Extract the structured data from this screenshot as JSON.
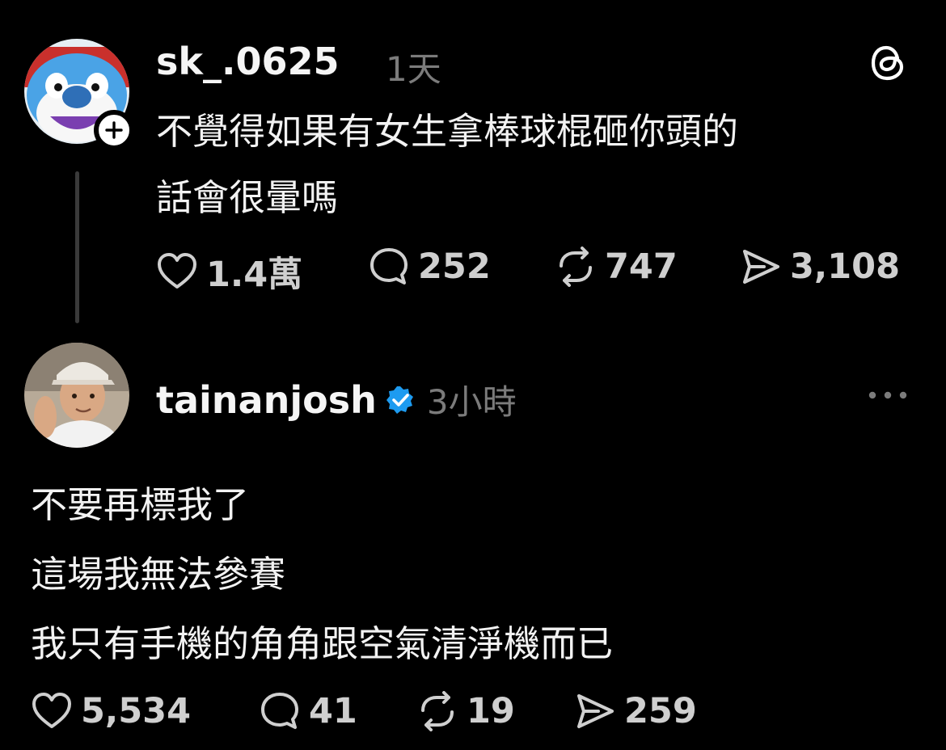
{
  "colors": {
    "background": "#000000",
    "text_primary": "#f2f2f2",
    "text_secondary": "#7b7b7b",
    "stat_color": "#cfcfcf",
    "verified_blue": "#1d9bf0"
  },
  "post": {
    "username": "sk_.0625",
    "timestamp": "1天",
    "text_lines": [
      "不覺得如果有女生拿棒球棍砸你頭的",
      "話會很暈嗎"
    ],
    "stats": {
      "likes": "1.4萬",
      "replies": "252",
      "reposts": "747",
      "shares": "3,108"
    },
    "icons": {
      "header_right": "threads-logo-icon",
      "avatar_badge": "plus-icon"
    }
  },
  "reply": {
    "username": "tainanjosh",
    "verified": true,
    "timestamp": "3小時",
    "text_lines": [
      "不要再標我了",
      "這場我無法參賽",
      "我只有手機的角角跟空氣清淨機而已"
    ],
    "stats": {
      "likes": "5,534",
      "replies": "41",
      "reposts": "19",
      "shares": "259"
    },
    "icons": {
      "header_right": "more-options-icon",
      "badge": "verified-badge-icon"
    }
  }
}
